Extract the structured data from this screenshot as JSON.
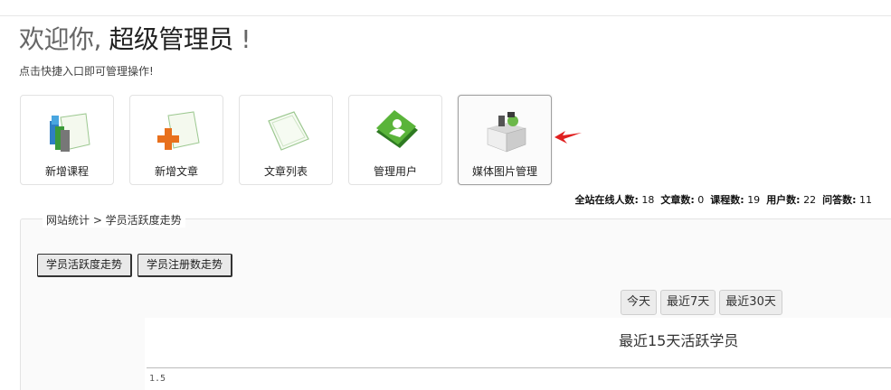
{
  "header": {
    "welcome_prefix": "欢迎你, ",
    "welcome_role": "超级管理员",
    "welcome_suffix": " !",
    "subtitle": "点击快捷入口即可管理操作!"
  },
  "quick_links": [
    {
      "label": "新增课程",
      "icon": "books-icon"
    },
    {
      "label": "新增文章",
      "icon": "add-document-icon"
    },
    {
      "label": "文章列表",
      "icon": "document-list-icon"
    },
    {
      "label": "管理用户",
      "icon": "user-book-icon"
    },
    {
      "label": "媒体图片管理",
      "icon": "media-box-icon"
    }
  ],
  "stats": {
    "online_label": "全站在线人数:",
    "online_value": "18",
    "articles_label": "文章数:",
    "articles_value": "0",
    "courses_label": "课程数:",
    "courses_value": "19",
    "users_label": "用户数:",
    "users_value": "22",
    "answers_label": "问答数:",
    "answers_value": "11"
  },
  "panel": {
    "breadcrumb": "网站统计 > 学员活跃度走势"
  },
  "chart_tabs": [
    {
      "label": "学员活跃度走势"
    },
    {
      "label": "学员注册数走势"
    }
  ],
  "range_buttons": [
    {
      "label": "今天"
    },
    {
      "label": "最近7天"
    },
    {
      "label": "最近30天"
    }
  ],
  "chart": {
    "title": "最近15天活跃学员",
    "first_tick": "1.5"
  },
  "colors": {
    "arrow": "#e02020",
    "plus": "#e8701c",
    "book_green": "#3a9a2a"
  }
}
